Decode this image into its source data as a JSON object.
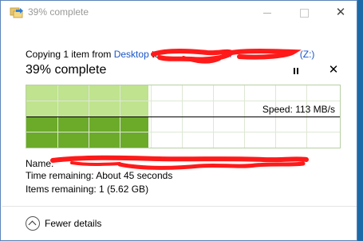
{
  "window": {
    "title": "39% complete"
  },
  "copy": {
    "prefix": "Copying 1 item from ",
    "source": "Desktop",
    "to_word": " to",
    "dest_partial": "\\\\",
    "dest_drive": "(Z:)"
  },
  "progress": {
    "headline": "39% complete",
    "percent": 39
  },
  "controls": {
    "pause_icon": "pause-icon",
    "stop_icon": "close-icon",
    "stop_glyph": "✕"
  },
  "graph": {
    "speed_label": "Speed: 113 MB/s"
  },
  "details": {
    "name_label": "Name:",
    "time_remaining": "Time remaining:  About 45 seconds",
    "items_remaining": "Items remaining:  1 (5.62 GB)"
  },
  "footer": {
    "fewer_details": "Fewer details"
  },
  "colors": {
    "link": "#1a55c8",
    "graph_light": "#bfe38e",
    "graph_dark": "#6caa2a",
    "redaction": "#ff1a1a"
  }
}
